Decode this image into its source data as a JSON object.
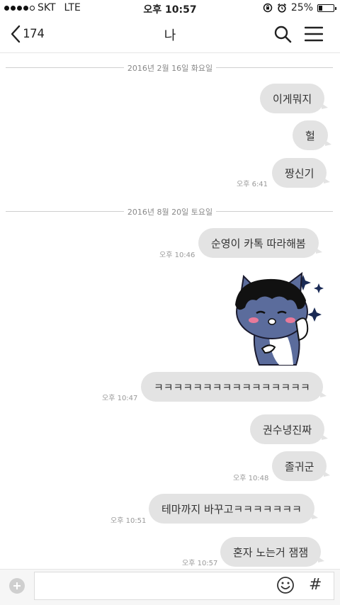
{
  "status_bar": {
    "carrier": "SKT",
    "network": "LTE",
    "time": "오후 10:57",
    "battery": "25%",
    "battery_level": 0.25
  },
  "nav": {
    "back_count": "174",
    "title": "나"
  },
  "chat": {
    "dates": [
      "2016년 2월 16일 화요일",
      "2016년 8월 20일 토요일"
    ],
    "messages": [
      {
        "text": "이게뭐지",
        "time": ""
      },
      {
        "text": "헐",
        "time": ""
      },
      {
        "text": "짱신기",
        "time": "오후 6:41"
      },
      {
        "text": "순영이 카톡 따라해봄",
        "time": "오후 10:46"
      },
      {
        "text": "ㅋㅋㅋㅋㅋㅋㅋㅋㅋㅋㅋㅋㅋㅋㅋㅋ",
        "time": "오후 10:47"
      },
      {
        "text": "권수녕진짜",
        "time": ""
      },
      {
        "text": "졸귀군",
        "time": "오후 10:48"
      },
      {
        "text": "테마까지 바꾸고ㅋㅋㅋㅋㅋㅋㅋ",
        "time": "오후 10:51"
      },
      {
        "text": "혼자 노는거 잼잼",
        "time": "오후 10:57"
      }
    ]
  },
  "input": {
    "placeholder": "",
    "hash_symbol": "#"
  },
  "colors": {
    "bubble": "#e3e3e3",
    "background": "#ffffff",
    "sticker_cat": "#5b6c9c",
    "sticker_hair": "#111111"
  }
}
